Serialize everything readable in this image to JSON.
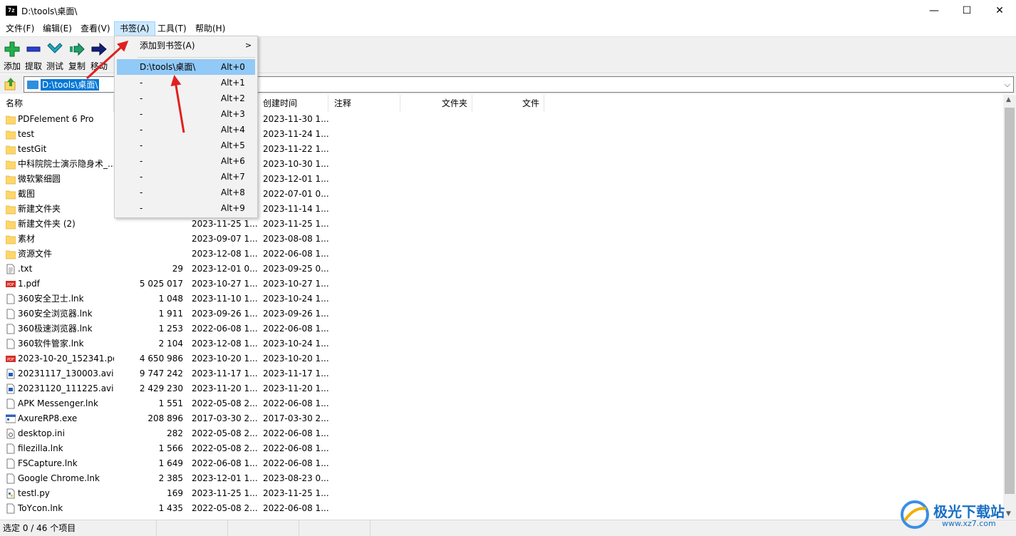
{
  "window": {
    "title": "D:\\tools\\桌面\\",
    "app_icon_text": "7z",
    "minimize": "—",
    "maximize": "☐",
    "close": "✕"
  },
  "menubar": [
    {
      "label": "文件(F)"
    },
    {
      "label": "编辑(E)"
    },
    {
      "label": "查看(V)"
    },
    {
      "label": "书签(A)",
      "active": true
    },
    {
      "label": "工具(T)"
    },
    {
      "label": "帮助(H)"
    }
  ],
  "toolbar": [
    {
      "label": "添加",
      "icon": "plus-icon",
      "color": "#22b14c"
    },
    {
      "label": "提取",
      "icon": "minus-icon",
      "color": "#2b3fcf"
    },
    {
      "label": "测试",
      "icon": "check-icon",
      "color": "#1aa9c0"
    },
    {
      "label": "复制",
      "icon": "copy-arrow-icon",
      "color": "#1fa06a"
    },
    {
      "label": "移动",
      "icon": "move-arrow-icon",
      "color": "#12207a"
    }
  ],
  "address": {
    "path": "D:\\tools\\桌面\\"
  },
  "columns": {
    "name": "名称",
    "created": "创建时间",
    "comment": "注释",
    "folders": "文件夹",
    "files": "文件"
  },
  "files": [
    {
      "name": "PDFelement 6 Pro",
      "size": "",
      "modified": "",
      "created": "2023-11-30 1...",
      "type": "folder"
    },
    {
      "name": "test",
      "size": "",
      "modified": "",
      "created": "2023-11-24 1...",
      "type": "folder"
    },
    {
      "name": "testGit",
      "size": "",
      "modified": "",
      "created": "2023-11-22 1...",
      "type": "folder"
    },
    {
      "name": "中科院院士演示隐身术_...",
      "size": "",
      "modified": "",
      "created": "2023-10-30 1...",
      "type": "folder"
    },
    {
      "name": "微软繁细圆",
      "size": "",
      "modified": "",
      "created": "2023-12-01 1...",
      "type": "folder"
    },
    {
      "name": "截图",
      "size": "",
      "modified": "",
      "created": "2022-07-01 0...",
      "type": "folder"
    },
    {
      "name": "新建文件夹",
      "size": "",
      "modified": "",
      "created": "2023-11-14 1...",
      "type": "folder"
    },
    {
      "name": "新建文件夹 (2)",
      "size": "",
      "modified": "2023-11-25 1...",
      "created": "2023-11-25 1...",
      "type": "folder"
    },
    {
      "name": "素材",
      "size": "",
      "modified": "2023-09-07 1...",
      "created": "2023-08-08 1...",
      "type": "folder"
    },
    {
      "name": "资源文件",
      "size": "",
      "modified": "2023-12-08 1...",
      "created": "2022-06-08 1...",
      "type": "folder"
    },
    {
      "name": ".txt",
      "size": "29",
      "modified": "2023-12-01 0...",
      "created": "2023-09-25 0...",
      "type": "text"
    },
    {
      "name": "1.pdf",
      "size": "5 025 017",
      "modified": "2023-10-27 1...",
      "created": "2023-10-27 1...",
      "type": "pdf"
    },
    {
      "name": "360安全卫士.lnk",
      "size": "1 048",
      "modified": "2023-11-10 1...",
      "created": "2023-10-24 1...",
      "type": "file"
    },
    {
      "name": "360安全浏览器.lnk",
      "size": "1 911",
      "modified": "2023-09-26 1...",
      "created": "2023-09-26 1...",
      "type": "file"
    },
    {
      "name": "360极速浏览器.lnk",
      "size": "1 253",
      "modified": "2022-06-08 1...",
      "created": "2022-06-08 1...",
      "type": "file"
    },
    {
      "name": "360软件管家.lnk",
      "size": "2 104",
      "modified": "2023-12-08 1...",
      "created": "2023-10-24 1...",
      "type": "file"
    },
    {
      "name": "2023-10-20_152341.pdf",
      "size": "4 650 986",
      "modified": "2023-10-20 1...",
      "created": "2023-10-20 1...",
      "type": "pdf"
    },
    {
      "name": "20231117_130003.avi",
      "size": "9 747 242",
      "modified": "2023-11-17 1...",
      "created": "2023-11-17 1...",
      "type": "video"
    },
    {
      "name": "20231120_111225.avi",
      "size": "2 429 230",
      "modified": "2023-11-20 1...",
      "created": "2023-11-20 1...",
      "type": "video"
    },
    {
      "name": "APK Messenger.lnk",
      "size": "1 551",
      "modified": "2022-05-08 2...",
      "created": "2022-06-08 1...",
      "type": "file"
    },
    {
      "name": "AxureRP8.exe",
      "size": "208 896",
      "modified": "2017-03-30 2...",
      "created": "2017-03-30 2...",
      "type": "exe"
    },
    {
      "name": "desktop.ini",
      "size": "282",
      "modified": "2022-05-08 2...",
      "created": "2022-06-08 1...",
      "type": "ini"
    },
    {
      "name": "filezilla.lnk",
      "size": "1 566",
      "modified": "2022-05-08 2...",
      "created": "2022-06-08 1...",
      "type": "file"
    },
    {
      "name": "FSCapture.lnk",
      "size": "1 649",
      "modified": "2022-06-08 1...",
      "created": "2022-06-08 1...",
      "type": "file"
    },
    {
      "name": "Google Chrome.lnk",
      "size": "2 385",
      "modified": "2023-12-01 1...",
      "created": "2023-08-23 0...",
      "type": "file"
    },
    {
      "name": "testl.py",
      "size": "169",
      "modified": "2023-11-25 1...",
      "created": "2023-11-25 1...",
      "type": "py"
    },
    {
      "name": "ToYcon.lnk",
      "size": "1 435",
      "modified": "2022-05-08 2...",
      "created": "2022-06-08 1...",
      "type": "file"
    }
  ],
  "status": {
    "selection": "选定 0 / 46 个项目"
  },
  "bookmark_menu": {
    "add_label": "添加到书签(A)",
    "submenu_arrow": ">",
    "items": [
      {
        "label": "D:\\tools\\桌面\\",
        "shortcut": "Alt+0",
        "selected": true
      },
      {
        "label": "-",
        "shortcut": "Alt+1"
      },
      {
        "label": "-",
        "shortcut": "Alt+2"
      },
      {
        "label": "-",
        "shortcut": "Alt+3"
      },
      {
        "label": "-",
        "shortcut": "Alt+4"
      },
      {
        "label": "-",
        "shortcut": "Alt+5"
      },
      {
        "label": "-",
        "shortcut": "Alt+6"
      },
      {
        "label": "-",
        "shortcut": "Alt+7"
      },
      {
        "label": "-",
        "shortcut": "Alt+8"
      },
      {
        "label": "-",
        "shortcut": "Alt+9"
      }
    ]
  },
  "watermark": {
    "text": "极光下载站",
    "url": "www.xz7.com"
  },
  "colors": {
    "accent": "#0078d7",
    "menu_highlight": "#91c9f7",
    "folder": "#ffd769",
    "arrow": "#e02020"
  }
}
